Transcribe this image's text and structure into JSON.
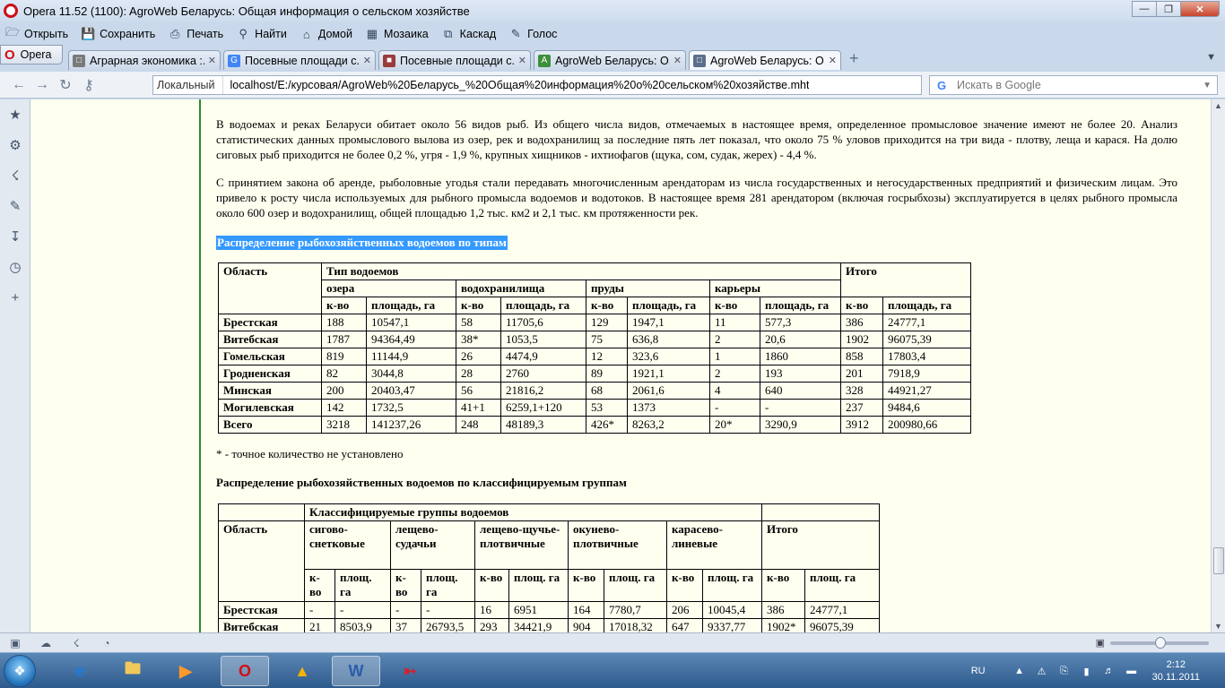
{
  "window": {
    "title": "Opera 11.52 (1100): AgroWeb Беларусь: Общая информация о сельском хозяйстве"
  },
  "menu": {
    "items": [
      {
        "label": "Открыть",
        "icon": "folder-icon"
      },
      {
        "label": "Сохранить",
        "icon": "save-icon"
      },
      {
        "label": "Печать",
        "icon": "print-icon"
      },
      {
        "label": "Найти",
        "icon": "search-icon"
      },
      {
        "label": "Домой",
        "icon": "home-icon"
      },
      {
        "label": "Мозаика",
        "icon": "tiles-icon"
      },
      {
        "label": "Каскад",
        "icon": "cascade-icon"
      },
      {
        "label": "Голос",
        "icon": "microphone-icon"
      }
    ]
  },
  "opera_button": "Opera",
  "tabs": [
    {
      "label": "Аграрная экономика :...",
      "active": false
    },
    {
      "label": "Посевные площади с...",
      "active": false
    },
    {
      "label": "Посевные площади с...",
      "active": false
    },
    {
      "label": "AgroWeb Беларусь: О...",
      "active": false
    },
    {
      "label": "AgroWeb Беларусь: О...",
      "active": true
    }
  ],
  "address": {
    "location_label": "Локальный",
    "url": "localhost/E:/курсовая/AgroWeb%20Беларусь_%20Общая%20информация%20о%20сельском%20хозяйстве.mht"
  },
  "search": {
    "placeholder": "Искать в Google"
  },
  "content": {
    "para1": "В водоемах и реках Беларуси обитает около 56 видов рыб. Из общего числа видов, отмечаемых в настоящее время, определенное промысловое значение имеют не более 20. Анализ статистических данных промыслового вылова из озер, рек и водохранилищ за последние пять лет показал, что около 75 % уловов приходится на три вида - плотву, леща и карася. На долю сиговых рыб приходится не более 0,2 %, угря - 1,9 %, крупных хищников - ихтиофагов (щука, сом, судак, жерех) - 4,4 %.",
    "para2": "С принятием закона об аренде, рыболовные угодья стали передавать многочисленным арендаторам из числа государственных и негосударственных предприятий и физическим лицам. Это привело к росту числа используемых для рыбного промысла водоемов и водотоков. В настоящее время 281 арендатором (включая госрыбхозы) эксплуатируется в целях рыбного промысла около 600 озер и водохранилищ, общей площадью 1,2 тыс. км2 и 2,1 тыс. км протяженности рек.",
    "heading1": "Распределение рыбохозяйственных водоемов по типам",
    "note": "* -   точное количество не установлено",
    "heading2": "Распределение рыбохозяйственных водоемов по классифицируемым группам"
  },
  "table1": {
    "h_region": "Область",
    "h_type": "Тип водоемов",
    "h_total": "Итого",
    "groups": [
      "озера",
      "водохранилища",
      "пруды",
      "карьеры"
    ],
    "sub": [
      "к-во",
      "площадь, га"
    ],
    "rows": [
      [
        "Брестская",
        "188",
        "10547,1",
        "58",
        "11705,6",
        "129",
        "1947,1",
        "11",
        "577,3",
        "386",
        "24777,1"
      ],
      [
        "Витебская",
        "1787",
        "94364,49",
        "38*",
        "1053,5",
        "75",
        "636,8",
        "2",
        "20,6",
        "1902",
        "96075,39"
      ],
      [
        "Гомельская",
        "819",
        "11144,9",
        "26",
        "4474,9",
        "12",
        "323,6",
        "1",
        "1860",
        "858",
        "17803,4"
      ],
      [
        "Гродненская",
        "82",
        "3044,8",
        "28",
        "2760",
        "89",
        "1921,1",
        "2",
        "193",
        "201",
        "7918,9"
      ],
      [
        "Минская",
        "200",
        "20403,47",
        "56",
        "21816,2",
        "68",
        "2061,6",
        "4",
        "640",
        "328",
        "44921,27"
      ],
      [
        "Могилевская",
        "142",
        "1732,5",
        "41+1",
        "6259,1+120",
        "53",
        "1373",
        "-",
        "-",
        "237",
        "9484,6"
      ],
      [
        "Всего",
        "3218",
        "141237,26",
        "248",
        "48189,3",
        "426*",
        "8263,2",
        "20*",
        "3290,9",
        "3912",
        "200980,66"
      ]
    ]
  },
  "table2": {
    "h_region": "Область",
    "h_groups": "Классифицируемые группы водоемов",
    "h_total": "Итого",
    "groups": [
      "сигово-снетковые",
      "лещево-судачьи",
      "лещево-щучье-плотвичные",
      "окунево-плотвичные",
      "карасево-линевые"
    ],
    "sub_cnt": "к-во",
    "sub_area": "площ. га",
    "rows": [
      [
        "Брестская",
        "-",
        "-",
        "-",
        "-",
        "16",
        "6951",
        "164",
        "7780,7",
        "206",
        "10045,4",
        "386",
        "24777,1"
      ],
      [
        "Витебская",
        "21",
        "8503,9",
        "37",
        "26793,5",
        "293",
        "34421,9",
        "904",
        "17018,32",
        "647",
        "9337,77",
        "1902*",
        "96075,39"
      ]
    ]
  },
  "taskbar": {
    "lang": "RU",
    "time": "2:12",
    "date": "30.11.2011"
  }
}
